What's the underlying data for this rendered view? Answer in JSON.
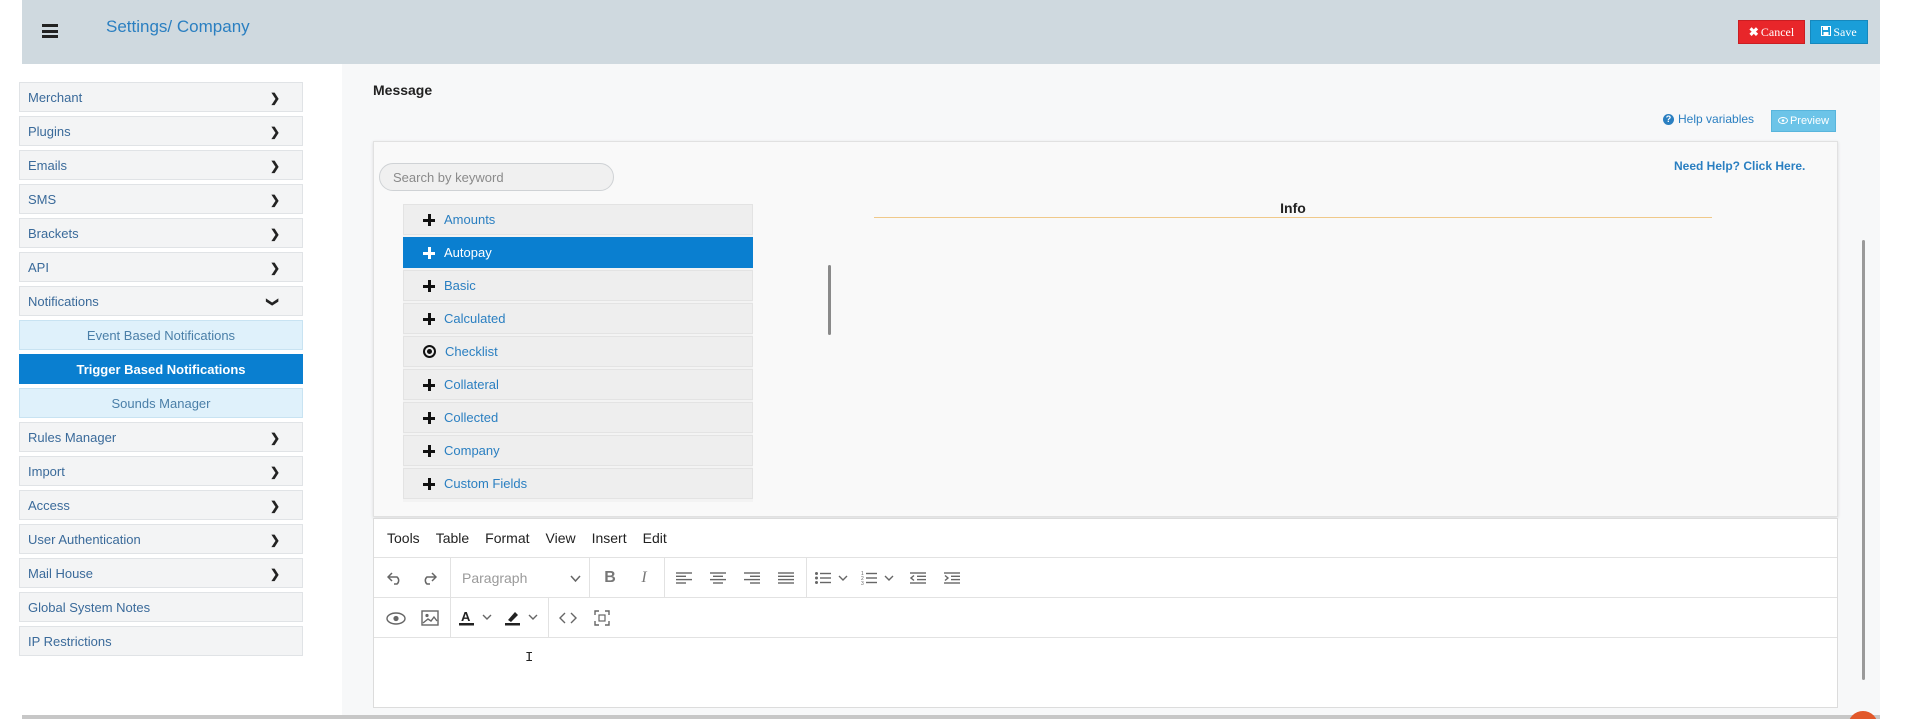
{
  "header": {
    "breadcrumb": [
      "Settings/",
      "Company"
    ],
    "cancel_label": "Cancel",
    "save_label": "Save"
  },
  "sidebar": {
    "items": [
      {
        "label": "Merchant",
        "expand": "chevron-right"
      },
      {
        "label": "Plugins",
        "expand": "chevron-right"
      },
      {
        "label": "Emails",
        "expand": "chevron-right"
      },
      {
        "label": "SMS",
        "expand": "chevron-right"
      },
      {
        "label": "Brackets",
        "expand": "chevron-right"
      },
      {
        "label": "API",
        "expand": "chevron-right"
      },
      {
        "label": "Notifications",
        "expand": "chevron-down"
      },
      {
        "label": "Rules Manager",
        "expand": "chevron-right"
      },
      {
        "label": "Import",
        "expand": "chevron-right"
      },
      {
        "label": "Access",
        "expand": "chevron-right"
      },
      {
        "label": "User Authentication",
        "expand": "chevron-right"
      },
      {
        "label": "Mail House",
        "expand": "chevron-right"
      },
      {
        "label": "Global System Notes",
        "expand": ""
      },
      {
        "label": "IP Restrictions",
        "expand": ""
      }
    ],
    "subitems": [
      {
        "label": "Event Based Notifications",
        "active": false
      },
      {
        "label": "Trigger Based Notifications",
        "active": true
      },
      {
        "label": "Sounds Manager",
        "active": false
      }
    ]
  },
  "main": {
    "section_title": "Message",
    "help_variables": "Help variables",
    "preview_label": "Preview",
    "search_placeholder": "Search by keyword",
    "need_help": "Need Help? Click Here.",
    "info_title": "Info",
    "variable_groups": [
      {
        "label": "Amounts",
        "icon": "plus-icon",
        "active": false
      },
      {
        "label": "Autopay",
        "icon": "plus-icon",
        "active": true
      },
      {
        "label": "Basic",
        "icon": "plus-icon",
        "active": false
      },
      {
        "label": "Calculated",
        "icon": "plus-icon",
        "active": false
      },
      {
        "label": "Checklist",
        "icon": "target-icon",
        "active": false
      },
      {
        "label": "Collateral",
        "icon": "plus-icon",
        "active": false
      },
      {
        "label": "Collected",
        "icon": "plus-icon",
        "active": false
      },
      {
        "label": "Company",
        "icon": "plus-icon",
        "active": false
      },
      {
        "label": "Custom Fields",
        "icon": "plus-icon",
        "active": false
      }
    ]
  },
  "editor": {
    "menu": [
      "Tools",
      "Table",
      "Format",
      "View",
      "Insert",
      "Edit"
    ],
    "block_format": "Paragraph",
    "cursor_glyph": "I"
  },
  "colors": {
    "topbar": "#cfd9df",
    "accent": "#0a7fd0",
    "cancel": "#e8262a",
    "save": "#1a9ed9",
    "link": "#2a7fc1"
  }
}
